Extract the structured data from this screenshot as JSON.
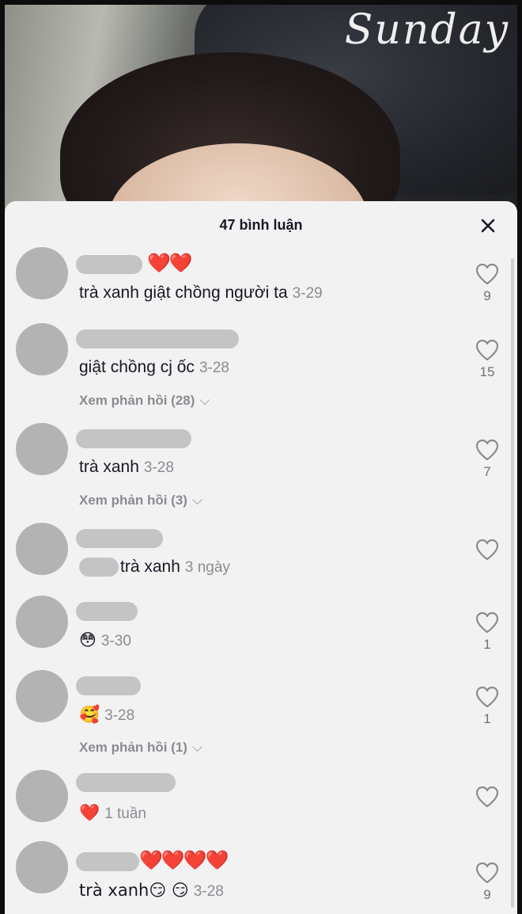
{
  "video": {
    "overlay_text": "Sunday"
  },
  "sheet": {
    "title": "47 bình luận",
    "close_icon": "close-icon"
  },
  "comments": [
    {
      "name_emojis": "❤️❤️",
      "text": "trà xanh giật chồng người ta",
      "date": "3-29",
      "likes": "9",
      "replies": ""
    },
    {
      "name_emojis": "",
      "text": "giật chồng cj ốc",
      "date": "3-28",
      "likes": "15",
      "replies": "Xem phản hồi (28)"
    },
    {
      "name_emojis": "",
      "text": "trà xanh",
      "date": "3-28",
      "likes": "7",
      "replies": "Xem phản hồi (3)"
    },
    {
      "name_emojis": "",
      "text": "trà xanh",
      "date": "3 ngày",
      "likes": "",
      "replies": ""
    },
    {
      "name_emojis": "",
      "text": "😳",
      "date": "3-30",
      "likes": "1",
      "replies": ""
    },
    {
      "name_emojis": "",
      "text": "🥰",
      "date": "3-28",
      "likes": "1",
      "replies": "Xem phản hồi (1)"
    },
    {
      "name_emojis": "",
      "text": "❤️",
      "date": "1 tuần",
      "likes": "",
      "replies": ""
    },
    {
      "name_emojis": "❤️❤️❤️❤️",
      "text": "trà xanh😏 😏",
      "date": "3-28",
      "likes": "9",
      "replies": ""
    }
  ],
  "colors": {
    "sheet_bg": "#f3f2f3",
    "avatar_gray": "#b3b3b3",
    "muted_text": "#8a8b91",
    "heart_red": "#e0212f"
  }
}
